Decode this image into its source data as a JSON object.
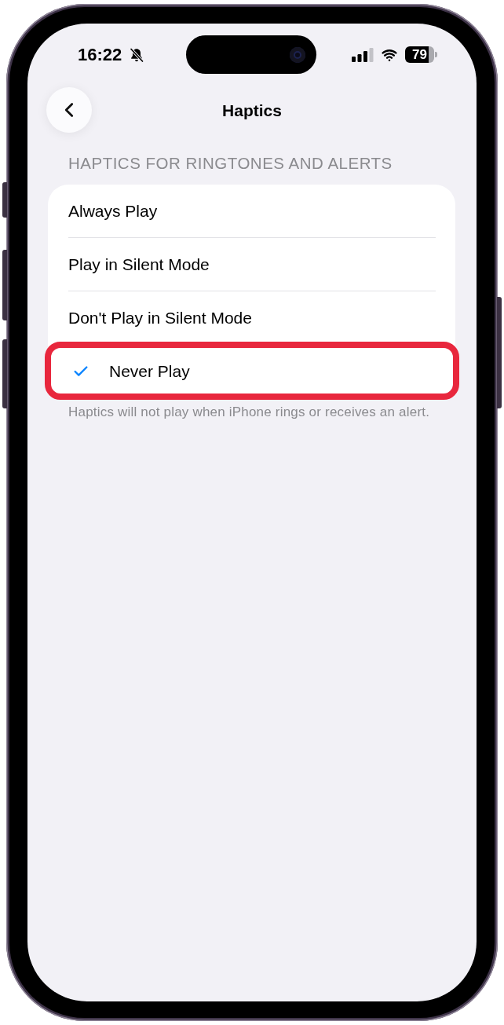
{
  "status_bar": {
    "time": "16:22",
    "silent": true,
    "battery": "79"
  },
  "nav": {
    "title": "Haptics"
  },
  "section": {
    "header": "HAPTICS FOR RINGTONES AND ALERTS",
    "options": [
      {
        "label": "Always Play",
        "selected": false,
        "highlighted": false
      },
      {
        "label": "Play in Silent Mode",
        "selected": false,
        "highlighted": false
      },
      {
        "label": "Don't Play in Silent Mode",
        "selected": false,
        "highlighted": false
      },
      {
        "label": "Never Play",
        "selected": true,
        "highlighted": true
      }
    ],
    "footer": "Haptics will not play when iPhone rings or receives an alert."
  }
}
